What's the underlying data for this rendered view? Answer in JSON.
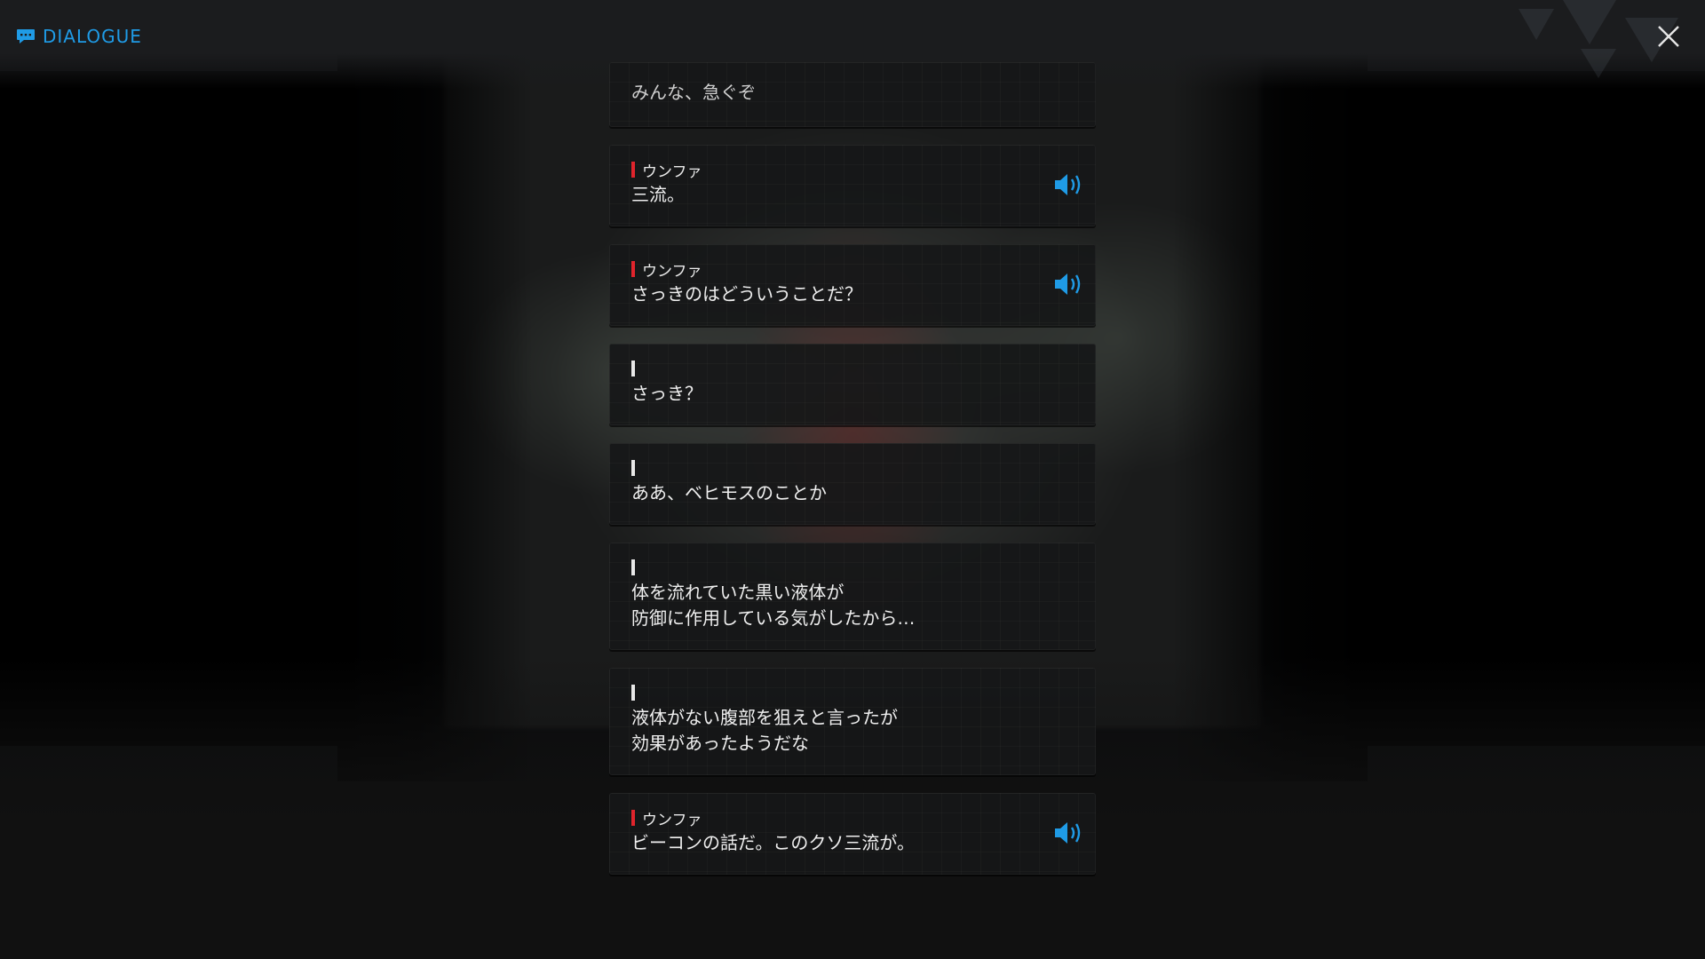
{
  "header": {
    "title": "DIALOGUE",
    "accent_color": "#1f9be6",
    "icons": {
      "title": "chat-bubble-icon",
      "close": "close-icon"
    }
  },
  "dialogue": [
    {
      "speaker": "",
      "lines": [
        "みんな、急ぐぞ"
      ],
      "voice": false,
      "marker_color": ""
    },
    {
      "speaker": "ウンファ",
      "lines": [
        "三流。"
      ],
      "voice": true,
      "marker_color": "#e0242c"
    },
    {
      "speaker": "ウンファ",
      "lines": [
        "さっきのはどういうことだ？"
      ],
      "voice": true,
      "marker_color": "#e0242c"
    },
    {
      "speaker": "",
      "lines": [
        "さっき？"
      ],
      "voice": false,
      "marker_color": "#e8e8e8"
    },
    {
      "speaker": "",
      "lines": [
        "ああ、ベヒモスのことか"
      ],
      "voice": false,
      "marker_color": "#e8e8e8"
    },
    {
      "speaker": "",
      "lines": [
        "体を流れていた黒い液体が",
        "防御に作用している気がしたから…"
      ],
      "voice": false,
      "marker_color": "#e8e8e8"
    },
    {
      "speaker": "",
      "lines": [
        "液体がない腹部を狙えと言ったが",
        "効果があったようだな"
      ],
      "voice": false,
      "marker_color": "#e8e8e8"
    },
    {
      "speaker": "ウンファ",
      "lines": [
        "ビーコンの話だ。このクソ三流が。"
      ],
      "voice": true,
      "marker_color": "#e0242c"
    }
  ],
  "voice_icon": "speaker-volume-icon"
}
